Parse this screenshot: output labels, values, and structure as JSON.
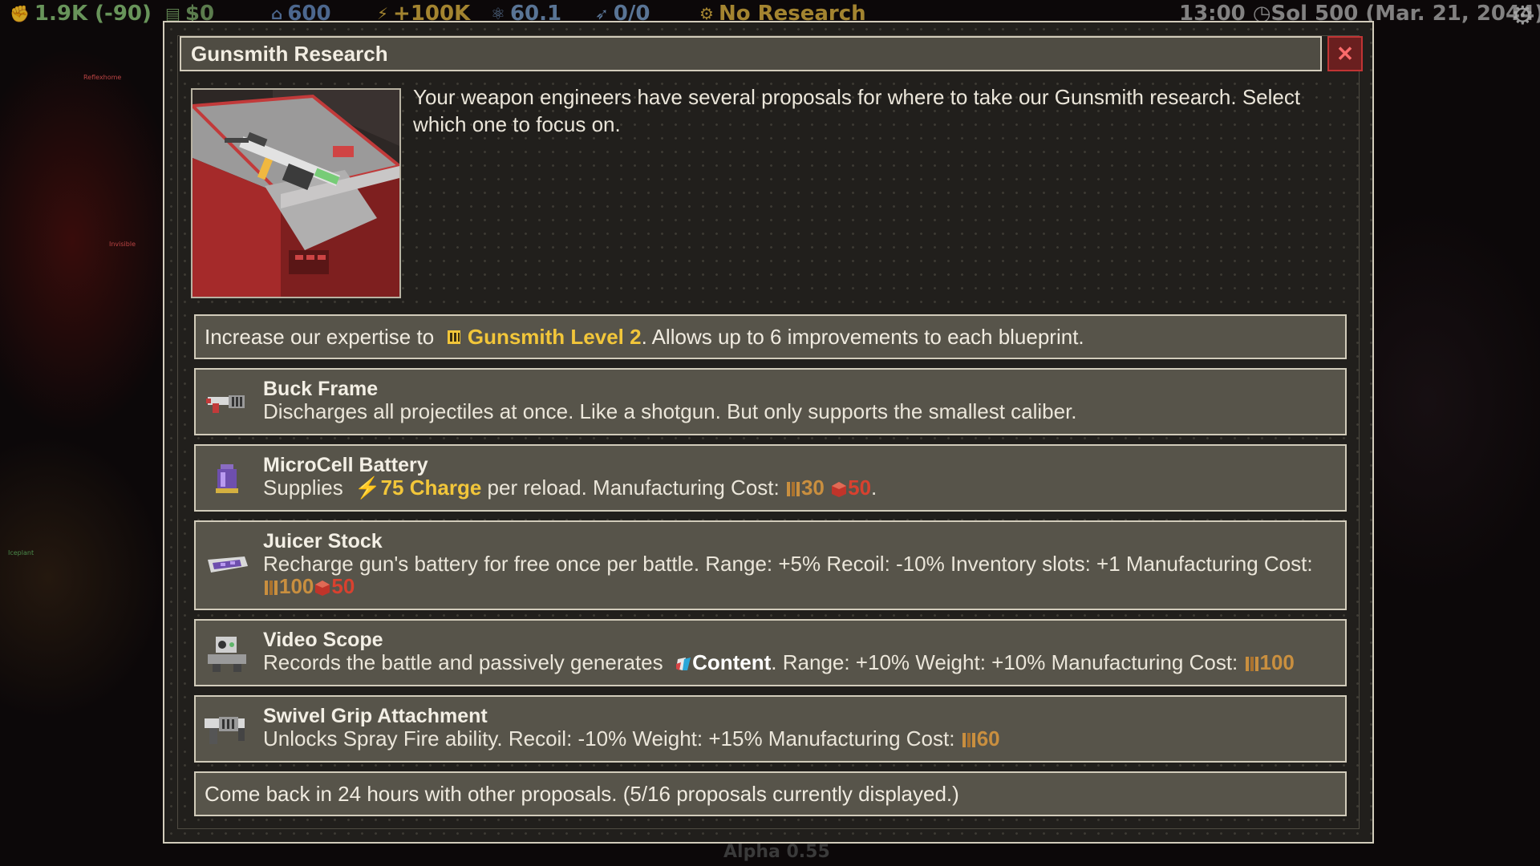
{
  "hud": {
    "population": "1.9K (-90)",
    "money": "$0",
    "bank": "600",
    "power": "+100K",
    "science": "60.1",
    "fuel": "0/0",
    "research": "No Research",
    "clock": "13:00 ◷Sol 500 (Mar. 21, 2044)"
  },
  "world_labels": [
    "Reflexhome",
    "Invisible",
    "Iceplant"
  ],
  "footer": {
    "version": "Alpha 0.55"
  },
  "dialog": {
    "title": "Gunsmith Research",
    "close_label": "✕",
    "intro": "Your weapon engineers have several proposals for where to take our Gunsmith research. Select which one to focus on.",
    "expertise": {
      "prefix": "Increase our expertise to",
      "level": "Gunsmith Level 2",
      "suffix": ". Allows up to 6 improvements to each blueprint."
    },
    "options": [
      {
        "title": "Buck Frame",
        "icon": "shotgun-frame-icon",
        "desc": "Discharges all projectiles at once. Like a shotgun. But only supports the smallest caliber."
      },
      {
        "title": "MicroCell Battery",
        "icon": "battery-icon",
        "desc_pre": "Supplies",
        "charge": "75 Charge",
        "desc_mid": "per reload. Manufacturing Cost:",
        "wood": "30",
        "metal": "50",
        "desc_end": "."
      },
      {
        "title": "Juicer Stock",
        "icon": "juicer-stock-icon",
        "desc": "Recharge gun's battery for free once per battle. Range: +5% Recoil: -10% Inventory slots: +1 Manufacturing Cost:",
        "wood": "100",
        "metal": "50"
      },
      {
        "title": "Video Scope",
        "icon": "video-scope-icon",
        "desc_pre": "Records the battle and passively generates",
        "content": "Content",
        "desc_mid": ". Range: +10% Weight: +10% Manufacturing Cost:",
        "wood": "100"
      },
      {
        "title": "Swivel Grip Attachment",
        "icon": "swivel-grip-icon",
        "desc": "Unlocks Spray Fire ability. Recoil: -10% Weight: +15% Manufacturing Cost:",
        "wood": "60"
      }
    ],
    "come_back": "Come back in 24 hours with other proposals. (5/16 proposals currently displayed.)"
  },
  "colors": {
    "panel_bg": "#211f1c",
    "option_bg": "#57544a",
    "border": "#d2ccbb",
    "highlight_yellow": "#f2c63a",
    "wood": "#c98f3f",
    "metal": "#d8412f",
    "close_red": "#c03434"
  }
}
